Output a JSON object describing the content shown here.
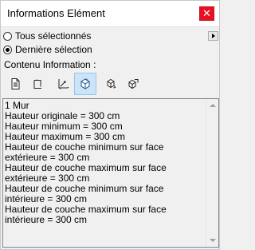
{
  "window": {
    "title": "Informations Elément",
    "close_label": "✕"
  },
  "selection": {
    "options": [
      {
        "label": "Tous sélectionnés",
        "checked": false
      },
      {
        "label": "Dernière sélection",
        "checked": true
      }
    ]
  },
  "content": {
    "label": "Contenu Information :",
    "tools": [
      {
        "icon": "document-icon",
        "active": false
      },
      {
        "icon": "height-icon",
        "active": false
      },
      {
        "icon": "measure-icon",
        "active": false
      },
      {
        "icon": "layer-3d-icon",
        "active": true
      },
      {
        "icon": "rotate-cube-icon",
        "active": false
      },
      {
        "icon": "cube-arrow-icon",
        "active": false
      }
    ]
  },
  "info": {
    "text": "1 Mur\nHauteur originale = 300 cm\nHauteur minimum = 300 cm\nHauteur maximum = 300 cm\nHauteur de couche minimum sur face extérieure = 300 cm\nHauteur de couche maximum sur face extérieure = 300 cm\nHauteur de couche minimum sur face intérieure = 300 cm\nHauteur de couche maximum sur face intérieure = 300 cm"
  },
  "colors": {
    "close_button": "#e81123",
    "active_tool": "#cce4f7"
  }
}
